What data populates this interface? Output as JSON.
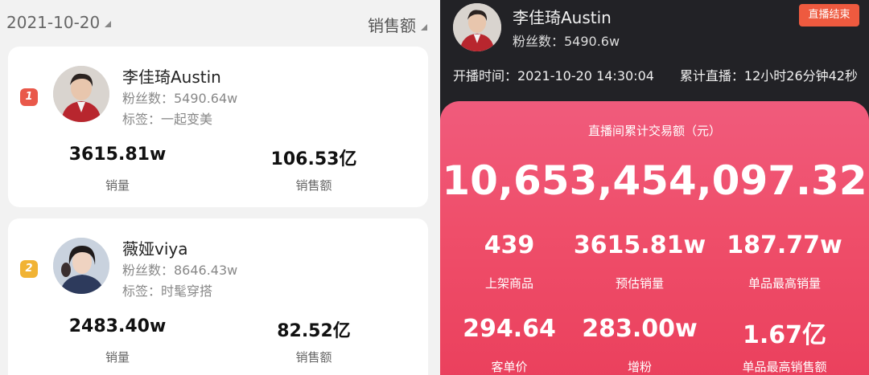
{
  "left": {
    "date": "2021-10-20",
    "sort_label": "销售额",
    "cards": [
      {
        "rank": "1",
        "name": "李佳琦Austin",
        "fans": "粉丝数：5490.64w",
        "tag": "标签：一起变美",
        "sales_value": "3615.81w",
        "sales_label": "销量",
        "revenue_value": "106.53亿",
        "revenue_label": "销售额"
      },
      {
        "rank": "2",
        "name": "薇娅viya",
        "fans": "粉丝数：8646.43w",
        "tag": "标签：时髦穿搭",
        "sales_value": "2483.40w",
        "sales_label": "销量",
        "revenue_value": "82.52亿",
        "revenue_label": "销售额"
      }
    ]
  },
  "right": {
    "name": "李佳琦Austin",
    "fans": "粉丝数：5490.6w",
    "end_button": "直播结束",
    "start_time": "开播时间：2021-10-20 14:30:04",
    "duration": "累计直播：12小时26分钟42秒",
    "gmv_label": "直播间累计交易额（元）",
    "gmv_value": "10,653,454,097.32",
    "stats": [
      {
        "value": "439",
        "label": "上架商品"
      },
      {
        "value": "3615.81w",
        "label": "预估销量"
      },
      {
        "value": "187.77w",
        "label": "单品最高销量"
      },
      {
        "value": "294.64",
        "label": "客单价"
      },
      {
        "value": "283.00w",
        "label": "增粉"
      },
      {
        "value": "1.67亿",
        "label": "单品最高销售额"
      }
    ]
  },
  "colors": {
    "rank1": "#e9584a",
    "rank2": "#f1b334",
    "end_button": "#ee5a3f",
    "panel_pink": "#ef4e6a",
    "dark_bg": "#222226"
  }
}
